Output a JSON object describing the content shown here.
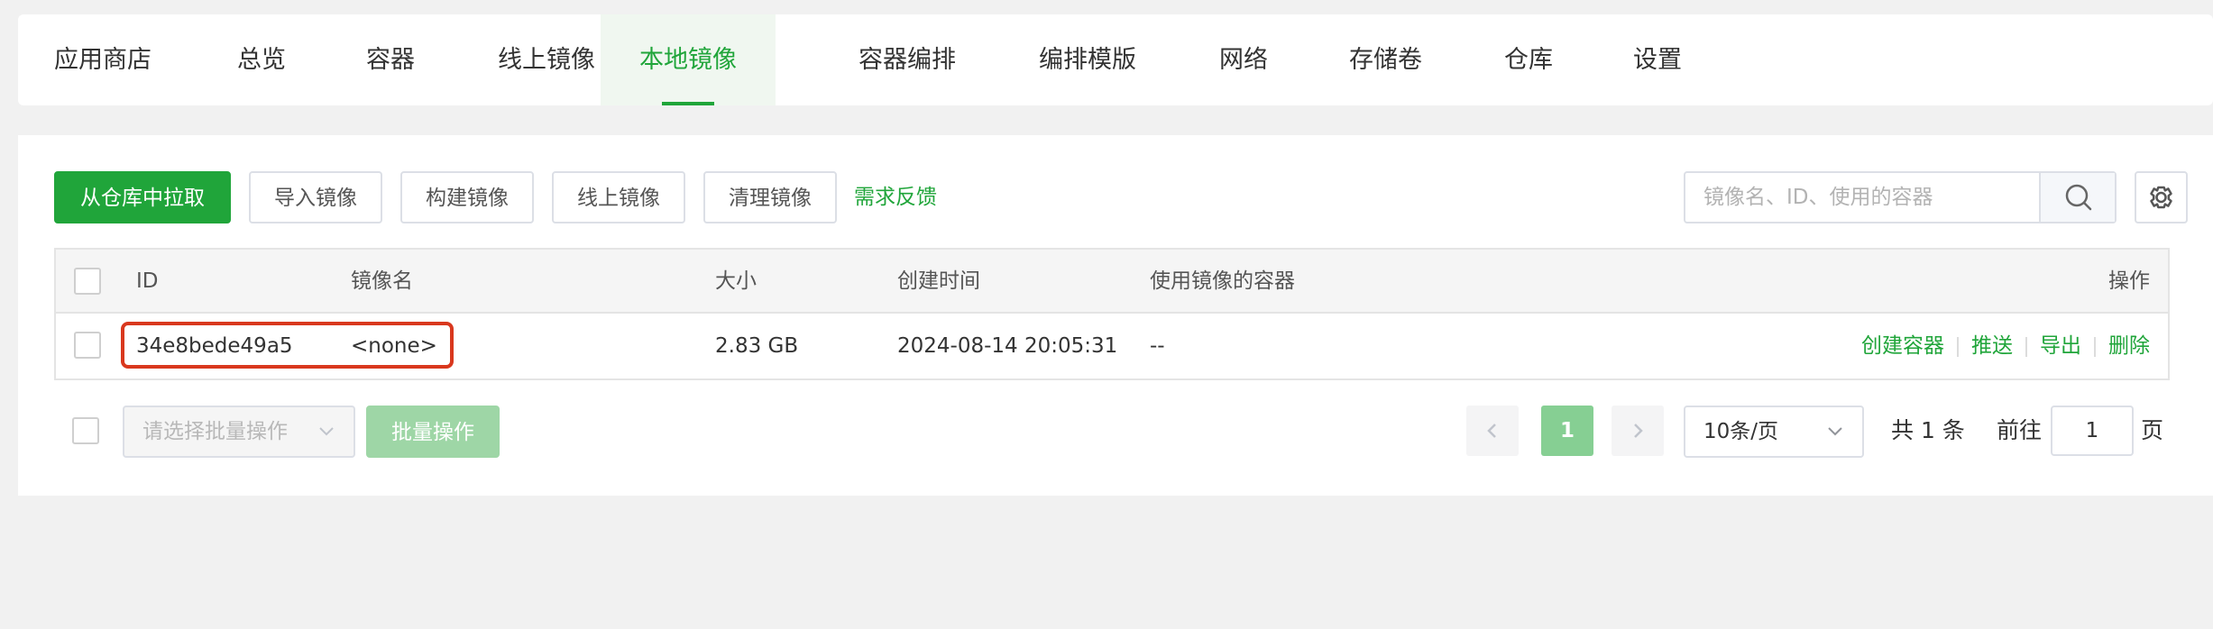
{
  "tabs": [
    {
      "label": "应用商店",
      "active": false
    },
    {
      "label": "总览",
      "active": false
    },
    {
      "label": "容器",
      "active": false
    },
    {
      "label": "线上镜像",
      "active": false
    },
    {
      "label": "本地镜像",
      "active": true
    },
    {
      "label": "容器编排",
      "active": false
    },
    {
      "label": "编排模版",
      "active": false
    },
    {
      "label": "网络",
      "active": false
    },
    {
      "label": "存储卷",
      "active": false
    },
    {
      "label": "仓库",
      "active": false
    },
    {
      "label": "设置",
      "active": false
    }
  ],
  "toolbar": {
    "pull_label": "从仓库中拉取",
    "import_label": "导入镜像",
    "build_label": "构建镜像",
    "online_label": "线上镜像",
    "clean_label": "清理镜像",
    "feedback_label": "需求反馈"
  },
  "search": {
    "placeholder": "镜像名、ID、使用的容器",
    "value": ""
  },
  "table": {
    "headers": {
      "id": "ID",
      "name": "镜像名",
      "size": "大小",
      "created": "创建时间",
      "containers": "使用镜像的容器",
      "actions": "操作"
    },
    "rows": [
      {
        "id": "34e8bede49a5",
        "name": "<none>",
        "size": "2.83 GB",
        "created": "2024-08-14 20:05:31",
        "containers": "--",
        "actions": [
          "创建容器",
          "推送",
          "导出",
          "删除"
        ]
      }
    ]
  },
  "footer": {
    "batch_placeholder": "请选择批量操作",
    "batch_button": "批量操作",
    "current_page": "1",
    "page_size": "10条/页",
    "total": "共 1 条",
    "goto_label": "前往",
    "goto_value": "1",
    "page_suffix": "页"
  },
  "colors": {
    "accent": "#20a53a",
    "highlight_border": "#d9381e"
  },
  "icons": {
    "search": "search-icon",
    "settings": "gear-icon",
    "prev": "chevron-left-icon",
    "next": "chevron-right-icon",
    "dropdown": "chevron-down-icon"
  }
}
